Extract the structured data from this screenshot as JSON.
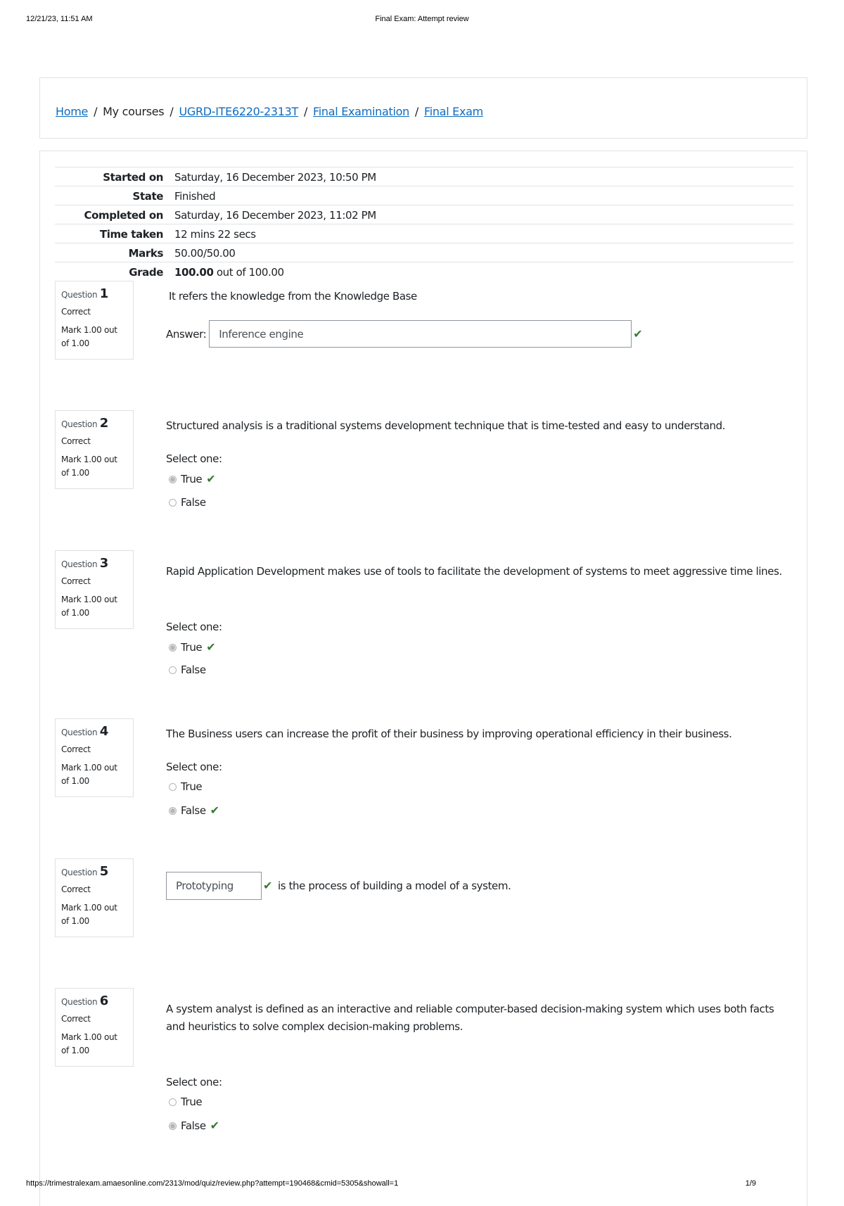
{
  "print": {
    "datetime": "12/21/23, 11:51 AM",
    "title": "Final Exam: Attempt review",
    "url": "https://trimestralexam.amaesonline.com/2313/mod/quiz/review.php?attempt=190468&cmid=5305&showall=1",
    "page": "1/9"
  },
  "breadcrumb": {
    "items": [
      {
        "label": "Home",
        "link": true
      },
      {
        "label": "My courses",
        "link": false
      },
      {
        "label": "UGRD-ITE6220-2313T",
        "link": true
      },
      {
        "label": "Final Examination",
        "link": true
      },
      {
        "label": "Final Exam",
        "link": true
      }
    ],
    "separator": "/"
  },
  "summary": {
    "rows": [
      {
        "label": "Started on",
        "value": "Saturday, 16 December 2023, 10:50 PM"
      },
      {
        "label": "State",
        "value": "Finished"
      },
      {
        "label": "Completed on",
        "value": "Saturday, 16 December 2023, 11:02 PM"
      },
      {
        "label": "Time taken",
        "value": "12 mins 22 secs"
      },
      {
        "label": "Marks",
        "value": "50.00/50.00"
      },
      {
        "label": "Grade",
        "value_bold": "100.00",
        "value_rest": " out of 100.00"
      }
    ]
  },
  "labels": {
    "question": "Question",
    "answer": "Answer:",
    "select_one": "Select one:"
  },
  "questions": [
    {
      "number": "1",
      "state": "Correct",
      "mark": "Mark 1.00 out of 1.00",
      "text": "It refers the knowledge from the Knowledge Base",
      "answer": "Inference engine"
    },
    {
      "number": "2",
      "state": "Correct",
      "mark": "Mark 1.00 out of 1.00",
      "text": "Structured analysis is a traditional systems development technique that is time-tested and easy to understand.",
      "options": [
        {
          "label": "True",
          "selected": true,
          "correct": true
        },
        {
          "label": "False",
          "selected": false
        }
      ]
    },
    {
      "number": "3",
      "state": "Correct",
      "mark": "Mark 1.00 out of 1.00",
      "text": "Rapid Application Development makes use of tools to facilitate the development of systems to meet aggressive time lines.",
      "options": [
        {
          "label": "True",
          "selected": true,
          "correct": true
        },
        {
          "label": "False",
          "selected": false
        }
      ]
    },
    {
      "number": "4",
      "state": "Correct",
      "mark": "Mark 1.00 out of 1.00",
      "text": "The Business users can increase the profit of their business by improving operational efficiency in their business.",
      "options": [
        {
          "label": "True",
          "selected": false
        },
        {
          "label": "False",
          "selected": true,
          "correct": true
        }
      ]
    },
    {
      "number": "5",
      "state": "Correct",
      "mark": "Mark 1.00 out of 1.00",
      "answer": "Prototyping",
      "text_after": "is the process of building a model of a system."
    },
    {
      "number": "6",
      "state": "Correct",
      "mark": "Mark 1.00 out of 1.00",
      "text": "A system analyst is defined as an interactive and reliable computer-based decision-making system which uses both facts and heuristics to solve complex decision-making problems.",
      "options": [
        {
          "label": "True",
          "selected": false
        },
        {
          "label": "False",
          "selected": true,
          "correct": true
        }
      ]
    }
  ],
  "colors": {
    "link": "#0f6cbf",
    "correct": "#357a32",
    "border": "#dee2e6"
  }
}
